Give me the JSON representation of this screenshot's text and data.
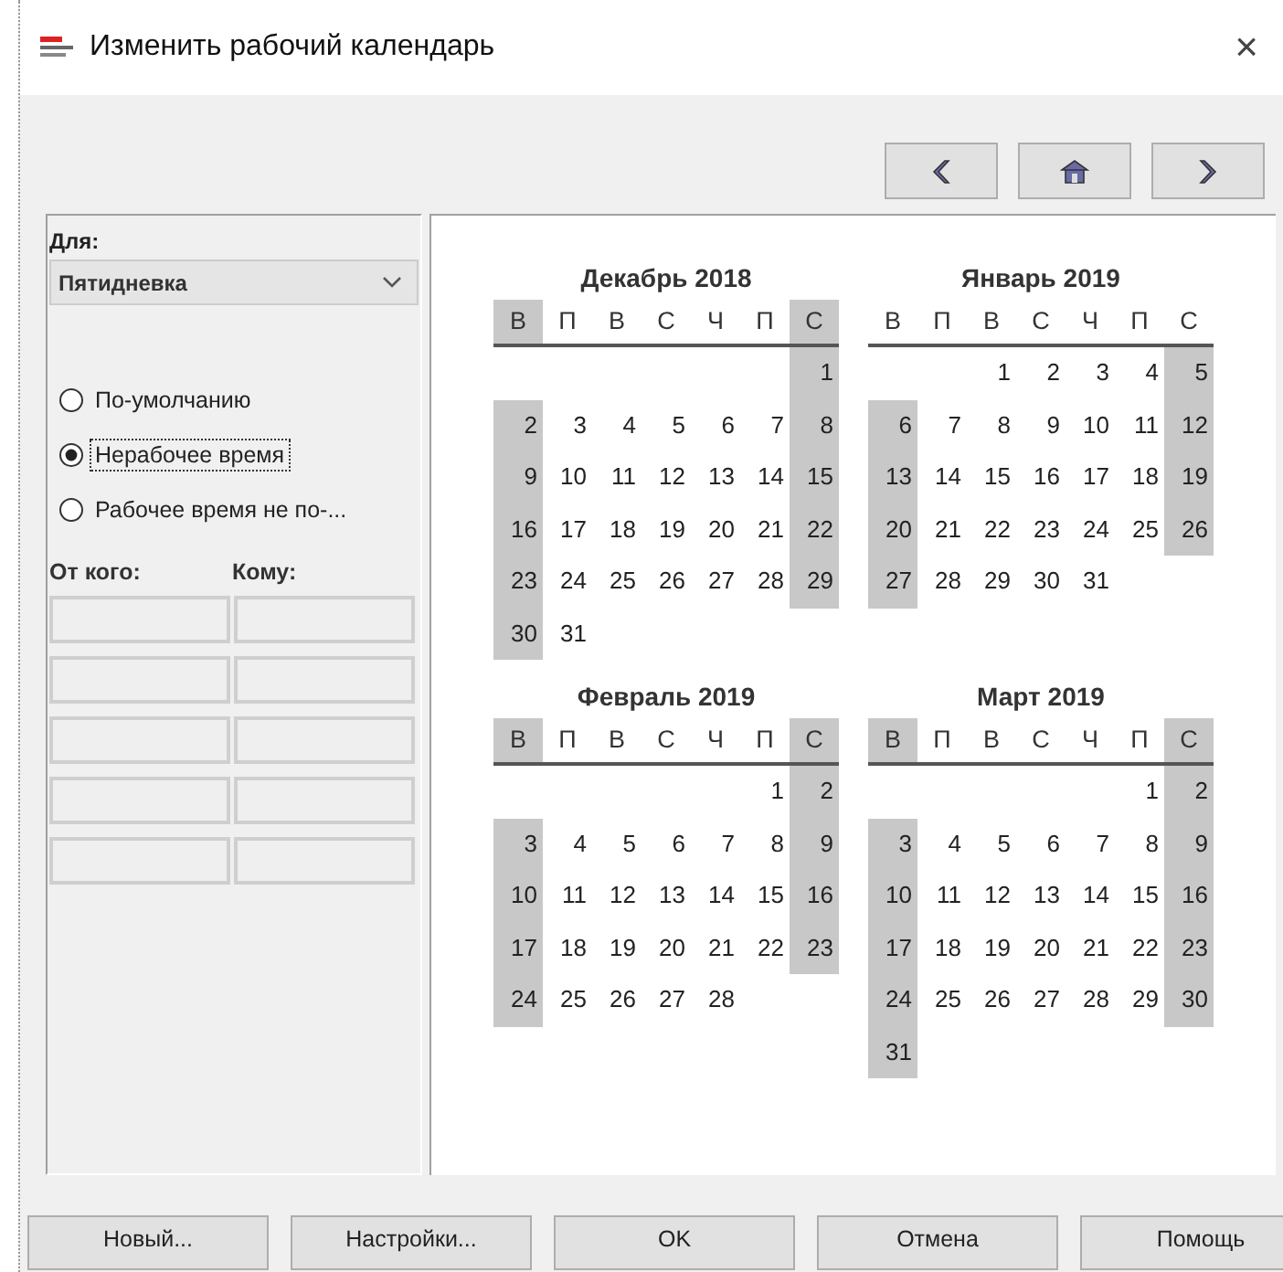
{
  "window": {
    "title": "Изменить рабочий календарь",
    "close": "×"
  },
  "nav_buttons": [
    {
      "kind": "prev"
    },
    {
      "kind": "home"
    },
    {
      "kind": "next"
    }
  ],
  "left_panel": {
    "for_label": "Для:",
    "calendar_select": {
      "value": "Пятидневка"
    },
    "radios": [
      {
        "label": "По-умолчанию",
        "selected": false
      },
      {
        "label": "Нерабочее время",
        "selected": true
      },
      {
        "label": "Рабочее время не по-...",
        "selected": false
      }
    ],
    "from_label": "От кого:",
    "to_label": "Кому:"
  },
  "months": [
    {
      "title": "Декабрь 2018",
      "weekdays": [
        {
          "label": "В",
          "shaded": true
        },
        {
          "label": "П",
          "shaded": false
        },
        {
          "label": "В",
          "shaded": false
        },
        {
          "label": "С",
          "shaded": false
        },
        {
          "label": "Ч",
          "shaded": false
        },
        {
          "label": "П",
          "shaded": false
        },
        {
          "label": "С",
          "shaded": true
        }
      ],
      "weeks": [
        [
          {
            "kind": "blank"
          },
          {
            "kind": "blank"
          },
          {
            "kind": "blank"
          },
          {
            "kind": "blank"
          },
          {
            "kind": "blank"
          },
          {
            "kind": "blank"
          },
          {
            "kind": "day",
            "d": "1",
            "shaded": true
          }
        ],
        [
          {
            "kind": "day",
            "d": "2",
            "shaded": true
          },
          {
            "kind": "day",
            "d": "3",
            "shaded": false
          },
          {
            "kind": "day",
            "d": "4",
            "shaded": false
          },
          {
            "kind": "day",
            "d": "5",
            "shaded": false
          },
          {
            "kind": "day",
            "d": "6",
            "shaded": false
          },
          {
            "kind": "day",
            "d": "7",
            "shaded": false
          },
          {
            "kind": "day",
            "d": "8",
            "shaded": true
          }
        ],
        [
          {
            "kind": "day",
            "d": "9",
            "shaded": true
          },
          {
            "kind": "day",
            "d": "10",
            "shaded": false
          },
          {
            "kind": "day",
            "d": "11",
            "shaded": false
          },
          {
            "kind": "day",
            "d": "12",
            "shaded": false
          },
          {
            "kind": "day",
            "d": "13",
            "shaded": false
          },
          {
            "kind": "day",
            "d": "14",
            "shaded": false
          },
          {
            "kind": "day",
            "d": "15",
            "shaded": true
          }
        ],
        [
          {
            "kind": "day",
            "d": "16",
            "shaded": true
          },
          {
            "kind": "day",
            "d": "17",
            "shaded": false
          },
          {
            "kind": "day",
            "d": "18",
            "shaded": false
          },
          {
            "kind": "day",
            "d": "19",
            "shaded": false
          },
          {
            "kind": "day",
            "d": "20",
            "shaded": false
          },
          {
            "kind": "day",
            "d": "21",
            "shaded": false
          },
          {
            "kind": "day",
            "d": "22",
            "shaded": true
          }
        ],
        [
          {
            "kind": "day",
            "d": "23",
            "shaded": true
          },
          {
            "kind": "day",
            "d": "24",
            "shaded": false
          },
          {
            "kind": "day",
            "d": "25",
            "shaded": false
          },
          {
            "kind": "day",
            "d": "26",
            "shaded": false
          },
          {
            "kind": "day",
            "d": "27",
            "shaded": false
          },
          {
            "kind": "day",
            "d": "28",
            "shaded": false
          },
          {
            "kind": "day",
            "d": "29",
            "shaded": true
          }
        ],
        [
          {
            "kind": "day",
            "d": "30",
            "shaded": true
          },
          {
            "kind": "day",
            "d": "31",
            "shaded": false
          }
        ]
      ]
    },
    {
      "title": "Январь 2019",
      "weekdays": [
        {
          "label": "В",
          "shaded": false
        },
        {
          "label": "П",
          "shaded": false
        },
        {
          "label": "В",
          "shaded": false
        },
        {
          "label": "С",
          "shaded": false
        },
        {
          "label": "Ч",
          "shaded": false
        },
        {
          "label": "П",
          "shaded": false
        },
        {
          "label": "С",
          "shaded": false
        }
      ],
      "weeks": [
        [
          {
            "kind": "blank"
          },
          {
            "kind": "blank"
          },
          {
            "kind": "day",
            "d": "1",
            "shaded": false
          },
          {
            "kind": "day",
            "d": "2",
            "shaded": false
          },
          {
            "kind": "day",
            "d": "3",
            "shaded": false
          },
          {
            "kind": "day",
            "d": "4",
            "shaded": false
          },
          {
            "kind": "day",
            "d": "5",
            "shaded": true
          }
        ],
        [
          {
            "kind": "day",
            "d": "6",
            "shaded": true
          },
          {
            "kind": "day",
            "d": "7",
            "shaded": false
          },
          {
            "kind": "day",
            "d": "8",
            "shaded": false
          },
          {
            "kind": "day",
            "d": "9",
            "shaded": false
          },
          {
            "kind": "day",
            "d": "10",
            "shaded": false
          },
          {
            "kind": "day",
            "d": "11",
            "shaded": false
          },
          {
            "kind": "day",
            "d": "12",
            "shaded": true
          }
        ],
        [
          {
            "kind": "day",
            "d": "13",
            "shaded": true
          },
          {
            "kind": "day",
            "d": "14",
            "shaded": false
          },
          {
            "kind": "day",
            "d": "15",
            "shaded": false
          },
          {
            "kind": "day",
            "d": "16",
            "shaded": false
          },
          {
            "kind": "day",
            "d": "17",
            "shaded": false
          },
          {
            "kind": "day",
            "d": "18",
            "shaded": false
          },
          {
            "kind": "day",
            "d": "19",
            "shaded": true
          }
        ],
        [
          {
            "kind": "day",
            "d": "20",
            "shaded": true
          },
          {
            "kind": "day",
            "d": "21",
            "shaded": false
          },
          {
            "kind": "day",
            "d": "22",
            "shaded": false
          },
          {
            "kind": "day",
            "d": "23",
            "shaded": false
          },
          {
            "kind": "day",
            "d": "24",
            "shaded": false
          },
          {
            "kind": "day",
            "d": "25",
            "shaded": false
          },
          {
            "kind": "day",
            "d": "26",
            "shaded": true
          }
        ],
        [
          {
            "kind": "day",
            "d": "27",
            "shaded": true
          },
          {
            "kind": "day",
            "d": "28",
            "shaded": false
          },
          {
            "kind": "day",
            "d": "29",
            "shaded": false
          },
          {
            "kind": "day",
            "d": "30",
            "shaded": false
          },
          {
            "kind": "day",
            "d": "31",
            "shaded": false
          }
        ]
      ]
    },
    {
      "title": "Февраль 2019",
      "weekdays": [
        {
          "label": "В",
          "shaded": true
        },
        {
          "label": "П",
          "shaded": false
        },
        {
          "label": "В",
          "shaded": false
        },
        {
          "label": "С",
          "shaded": false
        },
        {
          "label": "Ч",
          "shaded": false
        },
        {
          "label": "П",
          "shaded": false
        },
        {
          "label": "С",
          "shaded": true
        }
      ],
      "weeks": [
        [
          {
            "kind": "blank"
          },
          {
            "kind": "blank"
          },
          {
            "kind": "blank"
          },
          {
            "kind": "blank"
          },
          {
            "kind": "blank"
          },
          {
            "kind": "day",
            "d": "1",
            "shaded": false
          },
          {
            "kind": "day",
            "d": "2",
            "shaded": true
          }
        ],
        [
          {
            "kind": "day",
            "d": "3",
            "shaded": true
          },
          {
            "kind": "day",
            "d": "4",
            "shaded": false
          },
          {
            "kind": "day",
            "d": "5",
            "shaded": false
          },
          {
            "kind": "day",
            "d": "6",
            "shaded": false
          },
          {
            "kind": "day",
            "d": "7",
            "shaded": false
          },
          {
            "kind": "day",
            "d": "8",
            "shaded": false
          },
          {
            "kind": "day",
            "d": "9",
            "shaded": true
          }
        ],
        [
          {
            "kind": "day",
            "d": "10",
            "shaded": true
          },
          {
            "kind": "day",
            "d": "11",
            "shaded": false
          },
          {
            "kind": "day",
            "d": "12",
            "shaded": false
          },
          {
            "kind": "day",
            "d": "13",
            "shaded": false
          },
          {
            "kind": "day",
            "d": "14",
            "shaded": false
          },
          {
            "kind": "day",
            "d": "15",
            "shaded": false
          },
          {
            "kind": "day",
            "d": "16",
            "shaded": true
          }
        ],
        [
          {
            "kind": "day",
            "d": "17",
            "shaded": true
          },
          {
            "kind": "day",
            "d": "18",
            "shaded": false
          },
          {
            "kind": "day",
            "d": "19",
            "shaded": false
          },
          {
            "kind": "day",
            "d": "20",
            "shaded": false
          },
          {
            "kind": "day",
            "d": "21",
            "shaded": false
          },
          {
            "kind": "day",
            "d": "22",
            "shaded": false
          },
          {
            "kind": "day",
            "d": "23",
            "shaded": true
          }
        ],
        [
          {
            "kind": "day",
            "d": "24",
            "shaded": true
          },
          {
            "kind": "day",
            "d": "25",
            "shaded": false
          },
          {
            "kind": "day",
            "d": "26",
            "shaded": false
          },
          {
            "kind": "day",
            "d": "27",
            "shaded": false
          },
          {
            "kind": "day",
            "d": "28",
            "shaded": false
          }
        ]
      ]
    },
    {
      "title": "Март 2019",
      "weekdays": [
        {
          "label": "В",
          "shaded": true
        },
        {
          "label": "П",
          "shaded": false
        },
        {
          "label": "В",
          "shaded": false
        },
        {
          "label": "С",
          "shaded": false
        },
        {
          "label": "Ч",
          "shaded": false
        },
        {
          "label": "П",
          "shaded": false
        },
        {
          "label": "С",
          "shaded": true
        }
      ],
      "weeks": [
        [
          {
            "kind": "blank"
          },
          {
            "kind": "blank"
          },
          {
            "kind": "blank"
          },
          {
            "kind": "blank"
          },
          {
            "kind": "blank"
          },
          {
            "kind": "day",
            "d": "1",
            "shaded": false
          },
          {
            "kind": "day",
            "d": "2",
            "shaded": true
          }
        ],
        [
          {
            "kind": "day",
            "d": "3",
            "shaded": true
          },
          {
            "kind": "day",
            "d": "4",
            "shaded": false
          },
          {
            "kind": "day",
            "d": "5",
            "shaded": false
          },
          {
            "kind": "day",
            "d": "6",
            "shaded": false
          },
          {
            "kind": "day",
            "d": "7",
            "shaded": false
          },
          {
            "kind": "day",
            "d": "8",
            "shaded": false
          },
          {
            "kind": "day",
            "d": "9",
            "shaded": true
          }
        ],
        [
          {
            "kind": "day",
            "d": "10",
            "shaded": true
          },
          {
            "kind": "day",
            "d": "11",
            "shaded": false
          },
          {
            "kind": "day",
            "d": "12",
            "shaded": false
          },
          {
            "kind": "day",
            "d": "13",
            "shaded": false
          },
          {
            "kind": "day",
            "d": "14",
            "shaded": false
          },
          {
            "kind": "day",
            "d": "15",
            "shaded": false
          },
          {
            "kind": "day",
            "d": "16",
            "shaded": true
          }
        ],
        [
          {
            "kind": "day",
            "d": "17",
            "shaded": true
          },
          {
            "kind": "day",
            "d": "18",
            "shaded": false
          },
          {
            "kind": "day",
            "d": "19",
            "shaded": false
          },
          {
            "kind": "day",
            "d": "20",
            "shaded": false
          },
          {
            "kind": "day",
            "d": "21",
            "shaded": false
          },
          {
            "kind": "day",
            "d": "22",
            "shaded": false
          },
          {
            "kind": "day",
            "d": "23",
            "shaded": true
          }
        ],
        [
          {
            "kind": "day",
            "d": "24",
            "shaded": true
          },
          {
            "kind": "day",
            "d": "25",
            "shaded": false
          },
          {
            "kind": "day",
            "d": "26",
            "shaded": false
          },
          {
            "kind": "day",
            "d": "27",
            "shaded": false
          },
          {
            "kind": "day",
            "d": "28",
            "shaded": false
          },
          {
            "kind": "day",
            "d": "29",
            "shaded": false
          },
          {
            "kind": "day",
            "d": "30",
            "shaded": true
          }
        ],
        [
          {
            "kind": "day",
            "d": "31",
            "shaded": true
          }
        ]
      ]
    }
  ],
  "buttons": [
    {
      "label": "Новый..."
    },
    {
      "label": "Настройки..."
    },
    {
      "label": "OK"
    },
    {
      "label": "Отмена"
    },
    {
      "label": "Помощь"
    }
  ]
}
